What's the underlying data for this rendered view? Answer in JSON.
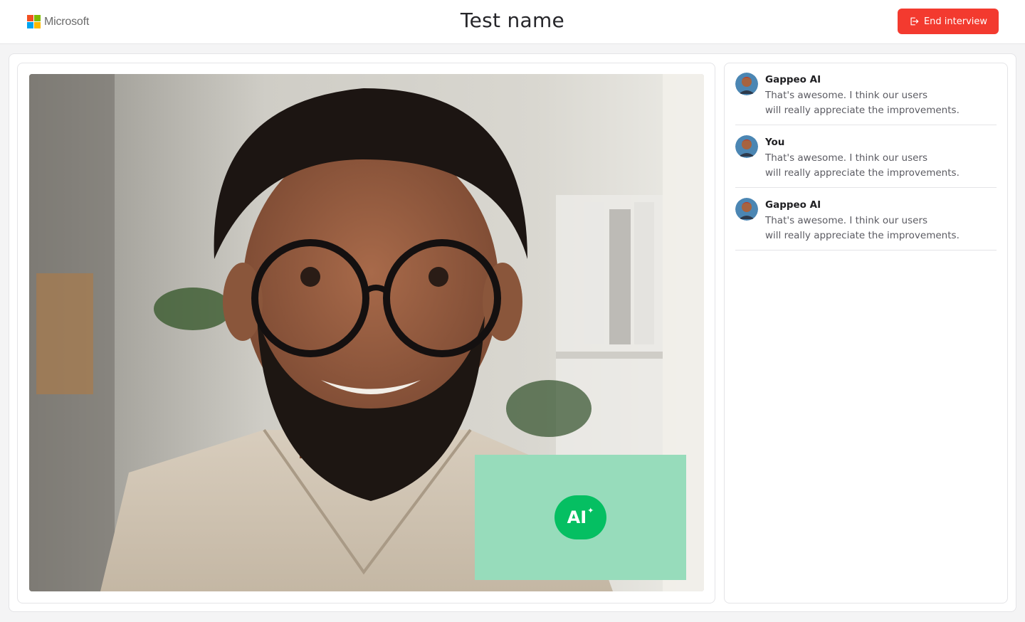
{
  "brand": {
    "name": "Microsoft"
  },
  "header": {
    "title": "Test name",
    "end_button_label": "End interview"
  },
  "ai_tile": {
    "label": "AI",
    "sparkle": "✦"
  },
  "chat": {
    "messages": [
      {
        "sender": "Gappeo AI",
        "line1": "That's awesome. I think our users",
        "line2": "will really appreciate the improvements."
      },
      {
        "sender": "You",
        "line1": "That's awesome. I think our users",
        "line2": "will really appreciate the improvements."
      },
      {
        "sender": "Gappeo AI",
        "line1": "That's awesome. I think our users",
        "line2": "will really appreciate the improvements."
      }
    ]
  },
  "colors": {
    "end_button": "#f33a2f",
    "ai_green": "#05bf62",
    "ai_tile_bg": "#97dcbb",
    "ms_red": "#f25022",
    "ms_green": "#7fba00",
    "ms_blue": "#00a4ef",
    "ms_yellow": "#ffb900"
  },
  "icons": {
    "logo": "microsoft-logo",
    "end": "exit-icon",
    "avatar": "user-avatar"
  }
}
